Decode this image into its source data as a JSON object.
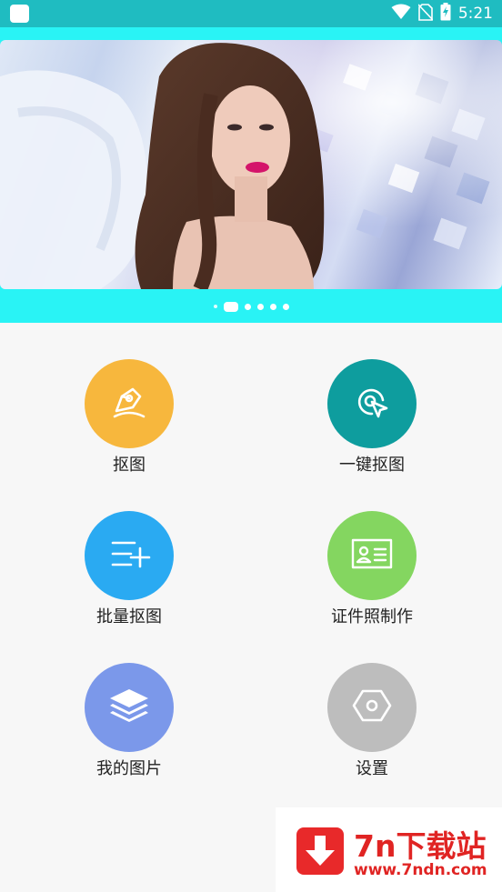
{
  "status_bar": {
    "time": "5:21",
    "background": "#1fbcc1",
    "icons": [
      "wifi-icon",
      "no-sim-icon",
      "battery-charging-icon"
    ]
  },
  "banner": {
    "image_description": "woman-with-white-angel-wings",
    "page_count": 6,
    "active_page": 2
  },
  "menu": [
    {
      "id": "cutout",
      "label": "抠图",
      "color": "#f7b73d",
      "icon": "pen-nib-icon"
    },
    {
      "id": "one-click-cutout",
      "label": "一键抠图",
      "color": "#0e9d9e",
      "icon": "target-cursor-icon"
    },
    {
      "id": "batch-cutout",
      "label": "批量抠图",
      "color": "#2aaaf2",
      "icon": "list-add-icon"
    },
    {
      "id": "id-photo",
      "label": "证件照制作",
      "color": "#84d660",
      "icon": "id-card-icon"
    },
    {
      "id": "my-pictures",
      "label": "我的图片",
      "color": "#7b98ea",
      "icon": "layers-icon"
    },
    {
      "id": "settings",
      "label": "设置",
      "color": "#bdbdbd",
      "icon": "hexagon-settings-icon"
    }
  ],
  "watermark": {
    "title": "7n下载站",
    "url": "www.7ndn.com",
    "color": "#e02423"
  }
}
